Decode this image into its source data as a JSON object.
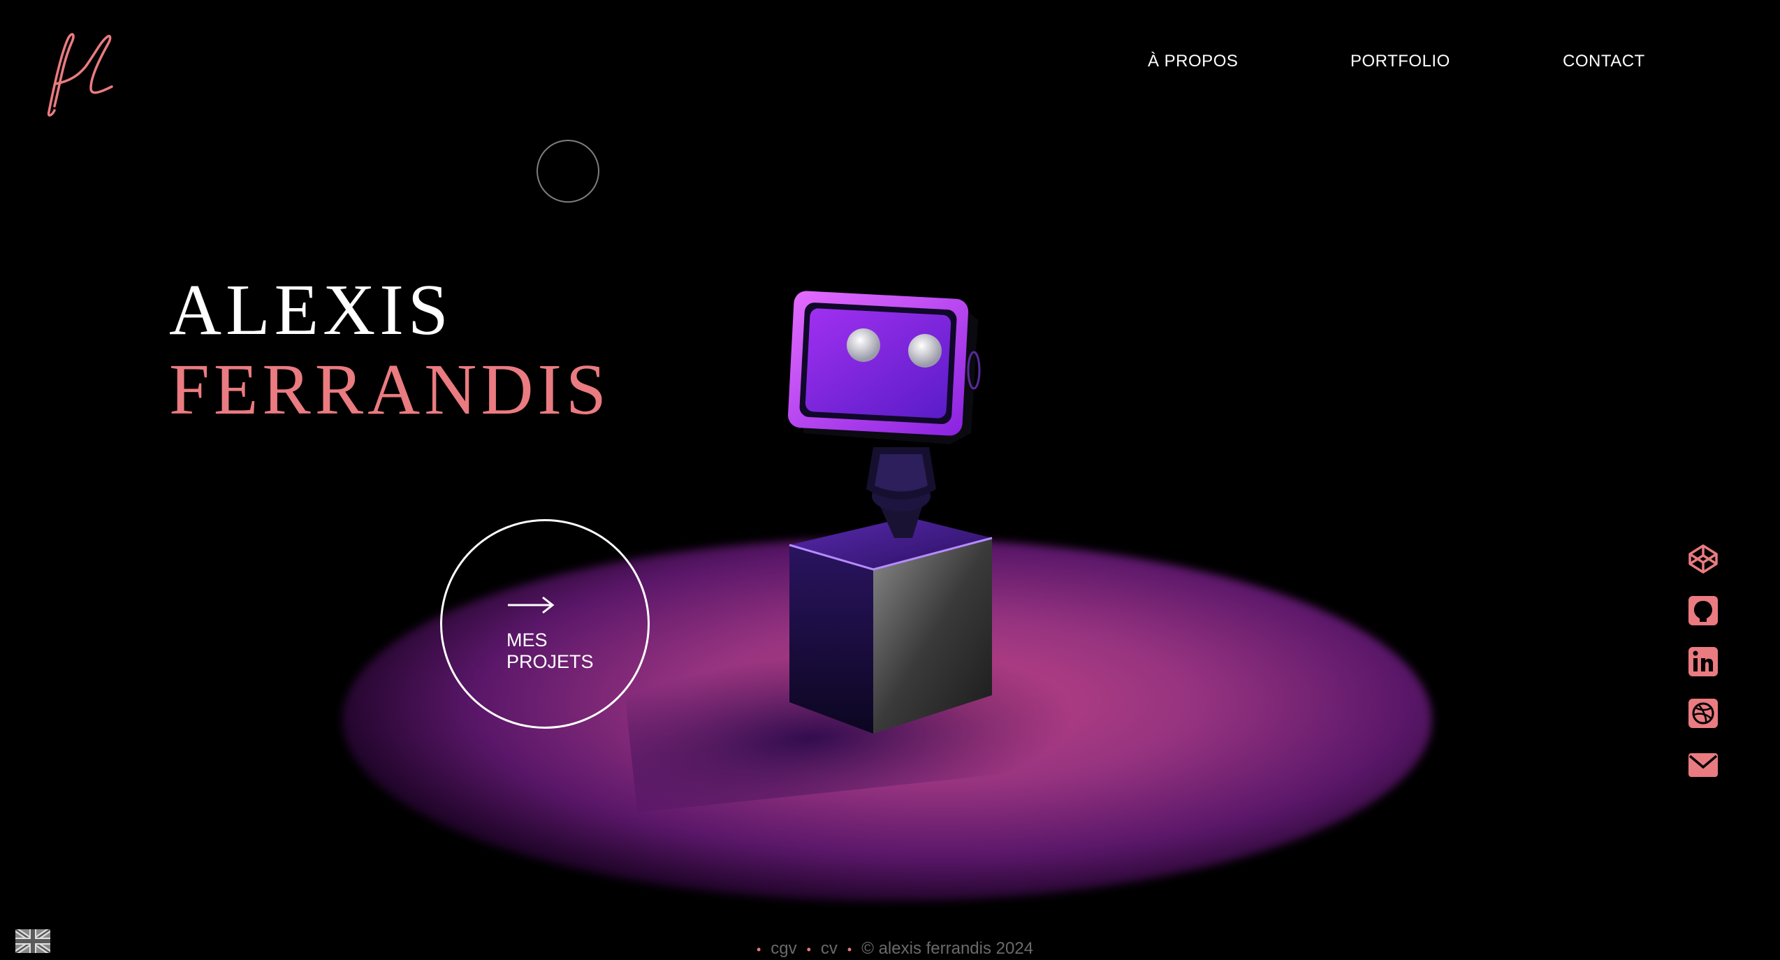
{
  "nav": {
    "about_label": "À PROPOS",
    "portfolio_label": "PORTFOLIO",
    "contact_label": "CONTACT"
  },
  "hero": {
    "first_name": "ALEXIS",
    "last_name": "FERRANDIS"
  },
  "cta": {
    "line1": "MES",
    "line2": "PROJETS",
    "icon": "arrow-right-icon"
  },
  "social": [
    {
      "name": "codepen-icon"
    },
    {
      "name": "github-icon"
    },
    {
      "name": "linkedin-icon"
    },
    {
      "name": "dribbble-icon"
    },
    {
      "name": "mail-icon"
    }
  ],
  "language": {
    "icon": "uk-flag-icon"
  },
  "footer": {
    "cgv_label": "cgv",
    "cv_label": "cv",
    "copyright": "© alexis ferrandis 2024"
  },
  "colors": {
    "background": "#000000",
    "accent": "#ea7b80",
    "social_icon": "#ea7b80",
    "text": "#ffffff",
    "footer_text": "#6a6a6a"
  }
}
